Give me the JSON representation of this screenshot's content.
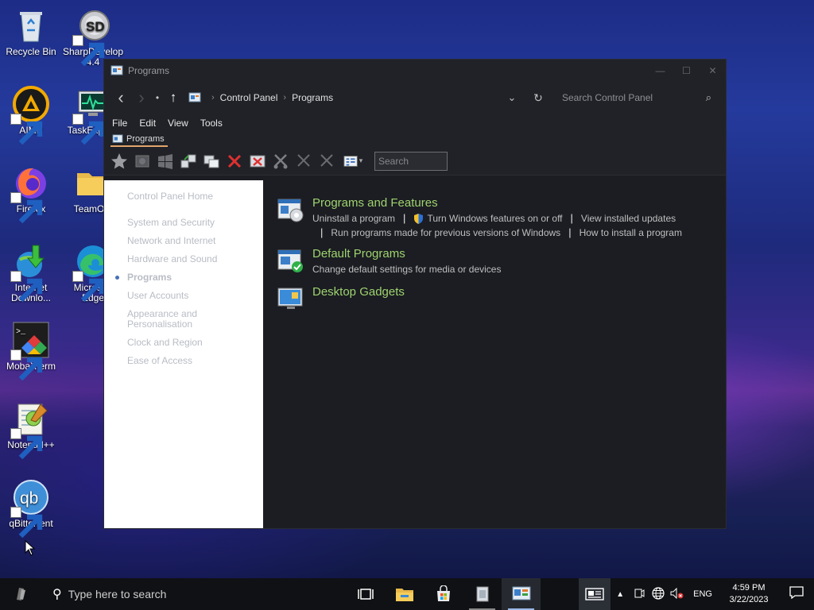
{
  "desktop": {
    "icons": [
      {
        "label": "Recycle Bin"
      },
      {
        "label": "SharpDevelop 4.4"
      },
      {
        "label": "AIMP"
      },
      {
        "label": "TaskExplo..."
      },
      {
        "label": "Firefox"
      },
      {
        "label": "TeamO..."
      },
      {
        "label": "Internet Downlo..."
      },
      {
        "label": "Microsoft Edge"
      },
      {
        "label": "MobaXterm"
      },
      {
        "label": "Notepad++"
      },
      {
        "label": "qBittorrent"
      }
    ]
  },
  "window": {
    "title": "Programs",
    "controls": {
      "minimize": "—",
      "maximize": "☐",
      "close": "✕"
    },
    "address": {
      "back": "‹",
      "forward": "›",
      "dot": "•",
      "up": "↑",
      "crumbs": [
        "Control Panel",
        "Programs"
      ],
      "crumb_sep": "›",
      "dropdown": "⌄",
      "refresh": "↻",
      "search_placeholder": "Search Control Panel",
      "search_icon": "⌕"
    },
    "menu": [
      "File",
      "Edit",
      "View",
      "Tools"
    ],
    "tab": {
      "label": "Programs"
    },
    "toolbar": {
      "search_placeholder": "Search"
    },
    "leftnav": {
      "home": "Control Panel Home",
      "items": [
        "System and Security",
        "Network and Internet",
        "Hardware and Sound",
        "Programs",
        "User Accounts",
        "Appearance and Personalisation",
        "Clock and Region",
        "Ease of Access"
      ],
      "active_index": 3
    },
    "categories": [
      {
        "title": "Programs and Features",
        "icon": "programs-features-icon",
        "links": [
          "Uninstall a program",
          "Turn Windows features on or off",
          "View installed updates",
          "Run programs made for previous versions of Windows",
          "How to install a program"
        ]
      },
      {
        "title": "Default Programs",
        "icon": "default-programs-icon",
        "links": [
          "Change default settings for media or devices"
        ]
      },
      {
        "title": "Desktop Gadgets",
        "icon": "desktop-gadgets-icon",
        "links": []
      }
    ]
  },
  "taskbar": {
    "search_placeholder": "Type here to search",
    "language": "ENG",
    "time": "4:59 PM",
    "date": "3/22/2023"
  },
  "colors": {
    "link_green": "#9fd36f",
    "tab_underline": "#e2a56b",
    "window_bg": "#1b1d22",
    "taskbar_bg": "#101114"
  }
}
